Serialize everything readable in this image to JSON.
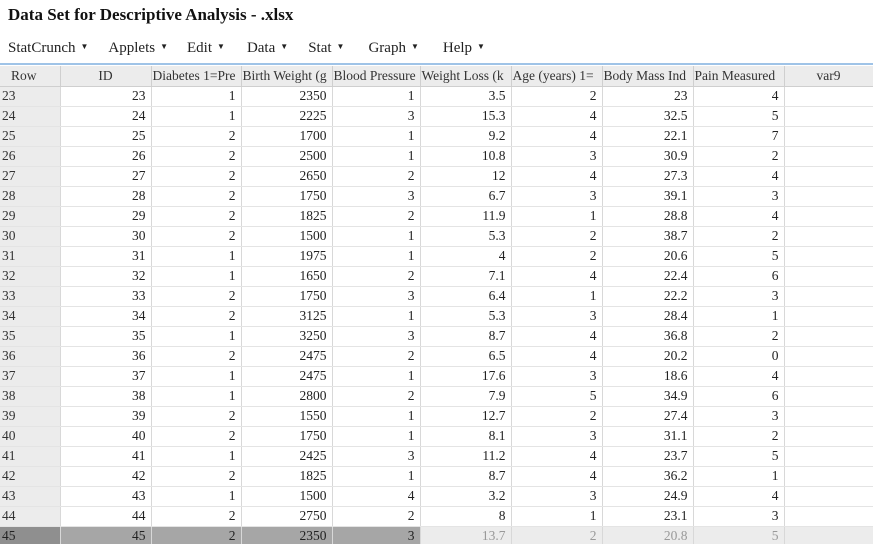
{
  "window": {
    "title": "Data Set for Descriptive Analysis - .xlsx"
  },
  "menu": {
    "items": [
      {
        "label": "StatCrunch",
        "name": "menu-statcrunch"
      },
      {
        "label": "Applets",
        "name": "menu-applets"
      },
      {
        "label": "Edit",
        "name": "menu-edit"
      },
      {
        "label": "Data",
        "name": "menu-data"
      },
      {
        "label": "Stat",
        "name": "menu-stat"
      },
      {
        "label": "Graph",
        "name": "menu-graph"
      },
      {
        "label": "Help",
        "name": "menu-help"
      }
    ],
    "caret_icon": "caret-down-icon"
  },
  "grid": {
    "row_header_label": "Row",
    "columns": [
      "ID",
      "Diabetes 1=Pre",
      "Birth Weight (g",
      "Blood Pressure",
      "Weight Loss (k",
      "Age (years) 1=",
      "Body Mass Ind",
      "Pain Measured",
      "var9"
    ],
    "rows": [
      {
        "row": "23",
        "cells": [
          "23",
          "1",
          "2350",
          "1",
          "3.5",
          "2",
          "23",
          "4",
          ""
        ]
      },
      {
        "row": "24",
        "cells": [
          "24",
          "1",
          "2225",
          "3",
          "15.3",
          "4",
          "32.5",
          "5",
          ""
        ]
      },
      {
        "row": "25",
        "cells": [
          "25",
          "2",
          "1700",
          "1",
          "9.2",
          "4",
          "22.1",
          "7",
          ""
        ]
      },
      {
        "row": "26",
        "cells": [
          "26",
          "2",
          "2500",
          "1",
          "10.8",
          "3",
          "30.9",
          "2",
          ""
        ]
      },
      {
        "row": "27",
        "cells": [
          "27",
          "2",
          "2650",
          "2",
          "12",
          "4",
          "27.3",
          "4",
          ""
        ]
      },
      {
        "row": "28",
        "cells": [
          "28",
          "2",
          "1750",
          "3",
          "6.7",
          "3",
          "39.1",
          "3",
          ""
        ]
      },
      {
        "row": "29",
        "cells": [
          "29",
          "2",
          "1825",
          "2",
          "11.9",
          "1",
          "28.8",
          "4",
          ""
        ]
      },
      {
        "row": "30",
        "cells": [
          "30",
          "2",
          "1500",
          "1",
          "5.3",
          "2",
          "38.7",
          "2",
          ""
        ]
      },
      {
        "row": "31",
        "cells": [
          "31",
          "1",
          "1975",
          "1",
          "4",
          "2",
          "20.6",
          "5",
          ""
        ]
      },
      {
        "row": "32",
        "cells": [
          "32",
          "1",
          "1650",
          "2",
          "7.1",
          "4",
          "22.4",
          "6",
          ""
        ]
      },
      {
        "row": "33",
        "cells": [
          "33",
          "2",
          "1750",
          "3",
          "6.4",
          "1",
          "22.2",
          "3",
          ""
        ]
      },
      {
        "row": "34",
        "cells": [
          "34",
          "2",
          "3125",
          "1",
          "5.3",
          "3",
          "28.4",
          "1",
          ""
        ]
      },
      {
        "row": "35",
        "cells": [
          "35",
          "1",
          "3250",
          "3",
          "8.7",
          "4",
          "36.8",
          "2",
          ""
        ]
      },
      {
        "row": "36",
        "cells": [
          "36",
          "2",
          "2475",
          "2",
          "6.5",
          "4",
          "20.2",
          "0",
          ""
        ]
      },
      {
        "row": "37",
        "cells": [
          "37",
          "1",
          "2475",
          "1",
          "17.6",
          "3",
          "18.6",
          "4",
          ""
        ]
      },
      {
        "row": "38",
        "cells": [
          "38",
          "1",
          "2800",
          "2",
          "7.9",
          "5",
          "34.9",
          "6",
          ""
        ]
      },
      {
        "row": "39",
        "cells": [
          "39",
          "2",
          "1550",
          "1",
          "12.7",
          "2",
          "27.4",
          "3",
          ""
        ]
      },
      {
        "row": "40",
        "cells": [
          "40",
          "2",
          "1750",
          "1",
          "8.1",
          "3",
          "31.1",
          "2",
          ""
        ]
      },
      {
        "row": "41",
        "cells": [
          "41",
          "1",
          "2425",
          "3",
          "11.2",
          "4",
          "23.7",
          "5",
          ""
        ]
      },
      {
        "row": "42",
        "cells": [
          "42",
          "2",
          "1825",
          "1",
          "8.7",
          "4",
          "36.2",
          "1",
          ""
        ]
      },
      {
        "row": "43",
        "cells": [
          "43",
          "1",
          "1500",
          "4",
          "3.2",
          "3",
          "24.9",
          "4",
          ""
        ]
      },
      {
        "row": "44",
        "cells": [
          "44",
          "2",
          "2750",
          "2",
          "8",
          "1",
          "23.1",
          "3",
          ""
        ]
      },
      {
        "row": "45",
        "cells": [
          "45",
          "2",
          "2350",
          "3",
          "13.7",
          "2",
          "20.8",
          "5",
          ""
        ],
        "selected": true,
        "selected_cells": 4
      }
    ]
  },
  "colors": {
    "header_bg": "#ececec",
    "accent_line": "#9fc3e7",
    "selected_row_header": "#8f8f8f",
    "selected_cell": "#a6a6a6"
  }
}
